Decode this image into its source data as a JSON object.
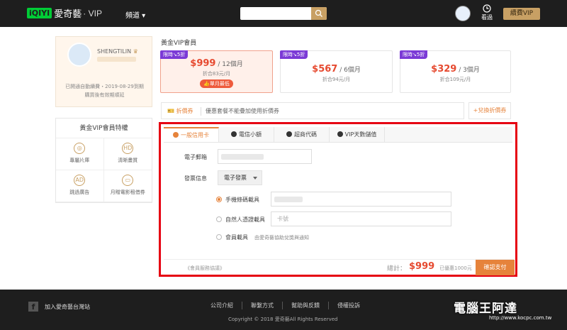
{
  "header": {
    "logo_mark": "iQIYI",
    "logo_text": "愛奇藝",
    "logo_vip": "· VIP",
    "channel_label": "頻道 ▾",
    "history_label": "看過",
    "renew_label": "續費VIP"
  },
  "profile": {
    "username": "SHENGTILIN",
    "crown": "♛",
    "note_line1": "已開通自動續費・2019-08-29到期",
    "note_line2": "購買後有效期順延"
  },
  "privileges": {
    "title": "黃金VIP會員特權",
    "items": [
      {
        "label": "專屬片庫",
        "icon": "film-icon",
        "glyph": "◎"
      },
      {
        "label": "清晰畫質",
        "icon": "hd-icon",
        "glyph": "HD"
      },
      {
        "label": "跳過廣告",
        "icon": "skip-ad-icon",
        "glyph": "AD"
      },
      {
        "label": "月贈電影租借券",
        "icon": "ticket-icon",
        "glyph": "▭"
      }
    ]
  },
  "plans": {
    "title": "黃金VIP會員",
    "items": [
      {
        "badge": "限時↘5折",
        "amount": "$999",
        "period": " / 12個月",
        "per_month": "折合83元/月",
        "tag": "👍單月最低"
      },
      {
        "badge": "限時↘5折",
        "amount": "$567",
        "period": " / 6個月",
        "per_month": "折合94元/月",
        "tag": ""
      },
      {
        "badge": "限時↘5折",
        "amount": "$329",
        "period": " / 3個月",
        "per_month": "折合109元/月",
        "tag": ""
      }
    ]
  },
  "coupon": {
    "label": "🎫 折價券",
    "text": "優惠套餐不能疊加使用折價券",
    "exchange_label": "+兌換折價券"
  },
  "payment": {
    "tabs": [
      "一般信用卡",
      "電信小額",
      "超商代碼",
      "VIP天數儲值"
    ],
    "email_label": "電子郵箱",
    "invoice_label": "發票信息",
    "invoice_type": "電子發票",
    "carrier_mobile_label": "手機條碼載具",
    "carrier_natural_label": "自然人憑證載具",
    "carrier_natural_placeholder": "卡號",
    "carrier_member_label": "會員載具",
    "carrier_member_hint": "由愛奇藝協助兌獎與通知",
    "agreement": "《會員服務協議》",
    "total_label": "總計：",
    "total_amount": "$999",
    "saved": "已優惠1000元",
    "confirm_label": "確認支付"
  },
  "footer": {
    "fb_glyph": "f",
    "join": "加入愛奇藝台灣站",
    "links": [
      "公司介紹",
      "聯繫方式",
      "幫助與反饋",
      "侵權投訴"
    ],
    "copyright": "Copyright © 2018 愛奇藝All Rights Reserved",
    "watermark": "電腦王阿達",
    "watermark_url": "http://www.kocpc.com.tw"
  }
}
